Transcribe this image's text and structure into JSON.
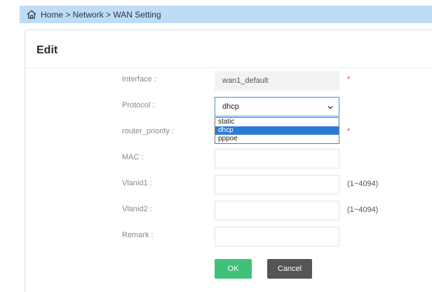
{
  "breadcrumb": {
    "text": "Home > Network > WAN Setting"
  },
  "panel": {
    "title": "Edit"
  },
  "form": {
    "interface": {
      "label": "Interface :",
      "value": "wan1_default",
      "required": "*"
    },
    "protocol": {
      "label": "Protocol :",
      "value": "dhcp",
      "options": [
        "static",
        "dhcp",
        "pppoe"
      ],
      "selected": "dhcp"
    },
    "router_priority": {
      "label": "router_priority :",
      "value": "",
      "required": "*"
    },
    "mac": {
      "label": "MAC :",
      "value": ""
    },
    "vlanid1": {
      "label": "Vlanid1 :",
      "value": "",
      "hint": "(1~4094)"
    },
    "vlanid2": {
      "label": "Vlanid2 :",
      "value": "",
      "hint": "(1~4094)"
    },
    "remark": {
      "label": "Remark :",
      "value": ""
    }
  },
  "buttons": {
    "ok": "OK",
    "cancel": "Cancel"
  },
  "icons": {
    "breadcrumb": "home-icon",
    "select": "chevron-down-icon"
  },
  "colors": {
    "breadcrumb_bg": "#bfdcf7",
    "ok": "#3ec27a",
    "cancel": "#555555",
    "selected_option": "#2b7bd6",
    "required": "#e53935"
  }
}
